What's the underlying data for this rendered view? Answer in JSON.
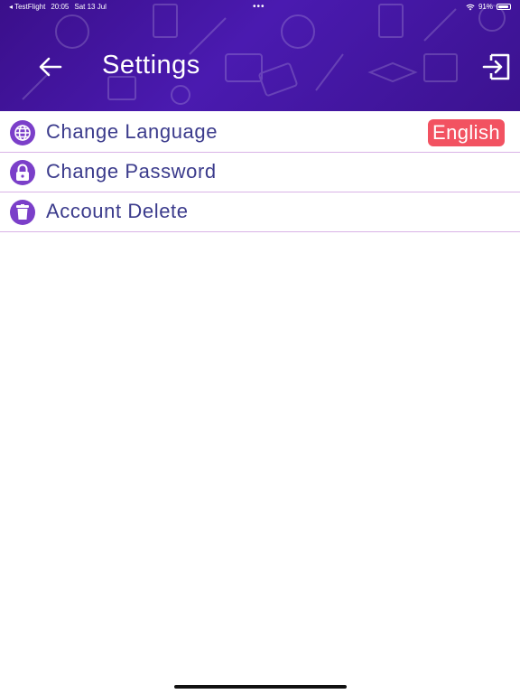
{
  "status_bar": {
    "back_app": "◂ TestFlight",
    "time": "20:05",
    "date": "Sat 13 Jul",
    "dots": "•••",
    "battery_percent": "91%",
    "battery_level": 0.91
  },
  "header": {
    "title": "Settings",
    "back_icon": "arrow-left-icon",
    "logout_icon": "logout-icon"
  },
  "settings": {
    "items": [
      {
        "label": "Change Language",
        "icon": "globe-icon",
        "value": "English"
      },
      {
        "label": "Change Password",
        "icon": "lock-icon"
      },
      {
        "label": "Account Delete",
        "icon": "trash-icon"
      }
    ]
  },
  "colors": {
    "header_bg": "#3f1599",
    "icon_bg": "#7b3fc9",
    "label_text": "#3b3b8c",
    "badge_bg": "#f25261",
    "divider": "#d9b3e6"
  }
}
